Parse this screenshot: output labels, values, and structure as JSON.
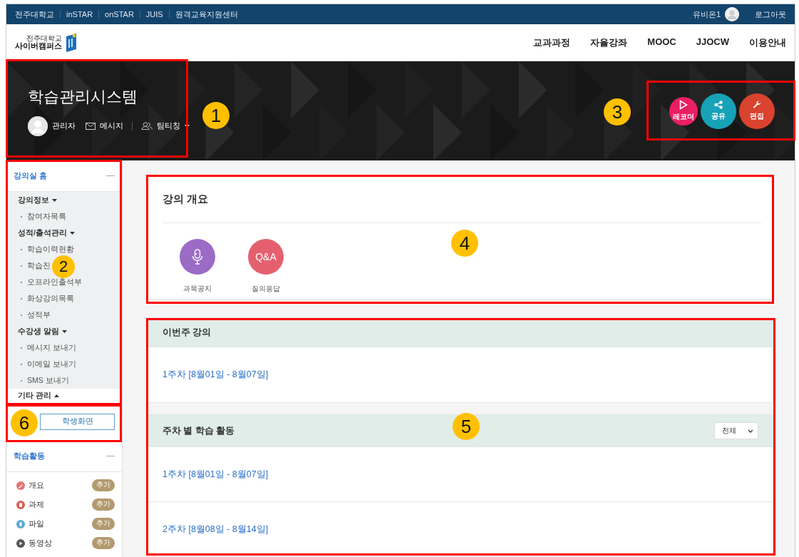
{
  "top_bar": {
    "links": [
      "전주대학교",
      "inSTAR",
      "onSTAR",
      "JUIS",
      "원격교육지원센터"
    ],
    "user": "유비온1",
    "logout": "로그아웃"
  },
  "header": {
    "logo_small": "전주대학교",
    "logo_large": "사이버캠퍼스",
    "nav": [
      "교과과정",
      "자율강좌",
      "MOOC",
      "JJOCW",
      "이용안내"
    ]
  },
  "course": {
    "title": "학습관리시스템",
    "professor": "관리자",
    "message": "메시지",
    "team": "팀티칭"
  },
  "actions": [
    {
      "label": "레코더",
      "kind": "play",
      "color": "#e91e63"
    },
    {
      "label": "공유",
      "kind": "share",
      "color": "#17a2b8"
    },
    {
      "label": "편집",
      "kind": "edit",
      "color": "#d9432f"
    }
  ],
  "sidebar": {
    "home": "강의실 홈",
    "groups": [
      {
        "title": "강의정보",
        "expanded": true,
        "children": [
          {
            "label": "참여자목록"
          }
        ]
      },
      {
        "title": "성적/출석관리",
        "expanded": true,
        "children": [
          {
            "label": "학습이력현황"
          },
          {
            "label": "학습진"
          },
          {
            "label": "오프라인출석부"
          },
          {
            "label": "화상강의목록"
          },
          {
            "label": "성적부"
          }
        ]
      },
      {
        "title": "수강생 알림",
        "expanded": true,
        "children": [
          {
            "label": "메시지 보내기"
          },
          {
            "label": "이메일 보내기"
          },
          {
            "label": "SMS 보내기"
          }
        ]
      },
      {
        "title": "기타 관리",
        "expanded": false
      }
    ],
    "student_view": "학생화면",
    "activities_title": "학습활동",
    "activities": [
      {
        "label": "개요",
        "kind": "overview",
        "color": "#e57373",
        "action": "추가"
      },
      {
        "label": "과제",
        "kind": "assignment",
        "color": "#e05a4e",
        "action": "추가"
      },
      {
        "label": "파일",
        "kind": "file",
        "color": "#5aa9d6",
        "action": "추가"
      },
      {
        "label": "동영상",
        "kind": "video",
        "color": "#555555",
        "action": "추가"
      }
    ]
  },
  "overview": {
    "title": "강의 개요",
    "items": [
      {
        "label": "과목공지",
        "kind": "mic",
        "color": "#9b6bc6"
      },
      {
        "label": "질의응답",
        "kind": "text",
        "icon_text": "Q&A",
        "color": "#e5606f"
      }
    ]
  },
  "this_week": {
    "title": "이번주 강의",
    "items": [
      "1주차 [8월01일 - 8월07일]"
    ]
  },
  "weekly": {
    "title": "주차 별 학습 활동",
    "filter": "전체",
    "items": [
      "1주차 [8월01일 - 8월07일]",
      "2주차 [8월08일 - 8월14일]"
    ]
  },
  "callouts": [
    {
      "label": "1"
    },
    {
      "label": "2"
    },
    {
      "label": "3"
    },
    {
      "label": "4"
    },
    {
      "label": "5"
    },
    {
      "label": "6"
    }
  ]
}
